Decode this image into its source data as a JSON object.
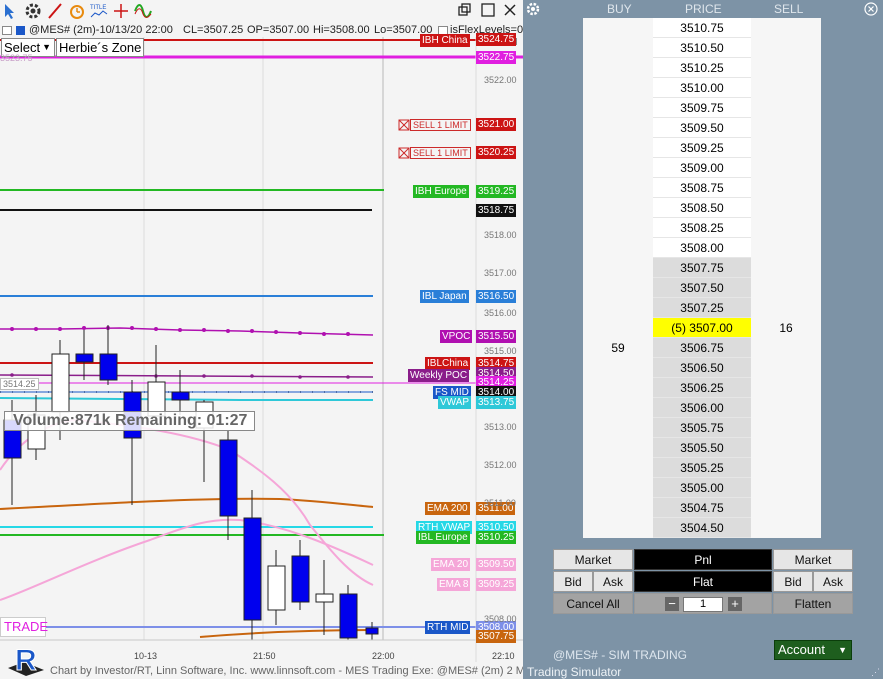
{
  "chart": {
    "title_parts": [
      "@MES# (2m)-10/13/20 22:00",
      "CL=3507.25",
      "OP=3507.00",
      "Hi=3508.00",
      "Lo=3507.00",
      "isFlexLevels=0",
      "M"
    ],
    "select_label": "Select",
    "zone_label": "Herbie´s Zone",
    "volume_text": "Volume:871k Remaining: 01:27",
    "trade_label": "TRADE",
    "footer": "Chart by Investor/RT, Linn Software, Inc. www.linnsoft.com - MES Trading Exe: @MES# (2m) 2 M",
    "left_price_tag": "3514.25",
    "faded_left_tag": "3523.75",
    "axis_ticks": [
      "3522.00",
      "3518.00",
      "3517.00",
      "3516.00",
      "3515.00",
      "3513.00",
      "3512.00",
      "3511.00",
      "3508.00"
    ],
    "time_ticks": [
      "10-13",
      "21:50",
      "22:00",
      "22:10"
    ],
    "level_labels": [
      {
        "text": "IBH China",
        "color": "#cc1414"
      },
      {
        "text": "SELL 1 LIMIT",
        "color": "#cc2a2a"
      },
      {
        "text": "SELL 1 LIMIT",
        "color": "#cc2a2a"
      },
      {
        "text": "IBH Europe",
        "color": "#23b823"
      },
      {
        "text": "IBL Japan",
        "color": "#2a7fd8"
      },
      {
        "text": "VPOC",
        "color": "#b010b0"
      },
      {
        "text": "IBLChina",
        "color": "#cc1414"
      },
      {
        "text": "Weekly POC",
        "color": "#8a1d8a"
      },
      {
        "text": "FS MID",
        "color": "#1a57c8"
      },
      {
        "text": "VWAP",
        "color": "#2ec8d8"
      },
      {
        "text": "EMA 200",
        "color": "#c8650e"
      },
      {
        "text": "RTH VWAP",
        "color": "#25d8e6"
      },
      {
        "text": "IBL Europe",
        "color": "#23b823"
      },
      {
        "text": "EMA 20",
        "color": "#f5a6d8"
      },
      {
        "text": "EMA 8",
        "color": "#f5a6d8"
      },
      {
        "text": "RTH MID",
        "color": "#1a57c8"
      }
    ],
    "price_labels": [
      {
        "text": "3524.75",
        "color": "#cc1414"
      },
      {
        "text": "3522.75",
        "color": "#e01fe0"
      },
      {
        "text": "3521.00",
        "color": "#cc1414"
      },
      {
        "text": "3520.25",
        "color": "#cc1414"
      },
      {
        "text": "3519.25",
        "color": "#23b823"
      },
      {
        "text": "3518.75",
        "color": "#111111"
      },
      {
        "text": "3516.50",
        "color": "#2a7fd8"
      },
      {
        "text": "3515.50",
        "color": "#b010b0"
      },
      {
        "text": "3514.75",
        "color": "#cc1414"
      },
      {
        "text": "3514.50",
        "color": "#8a1d8a"
      },
      {
        "text": "3514.25",
        "color": "#e01fe0"
      },
      {
        "text": "3514.00",
        "color": "#111111"
      },
      {
        "text": "3513.75",
        "color": "#2ec8d8"
      },
      {
        "text": "3511.00",
        "color": "#c8650e"
      },
      {
        "text": "3510.50",
        "color": "#25d8e6"
      },
      {
        "text": "3510.25",
        "color": "#23b823"
      },
      {
        "text": "3509.50",
        "color": "#f5a6d8"
      },
      {
        "text": "3509.25",
        "color": "#f5a6d8"
      },
      {
        "text": "3508.00",
        "color": "#7d8fe8"
      },
      {
        "text": "3507.75",
        "color": "#c8650e"
      }
    ]
  },
  "dom": {
    "headers": {
      "buy": "BUY",
      "price": "PRICE",
      "sell": "SELL"
    },
    "rows": [
      {
        "price": "3510.75",
        "buy": "",
        "sell": ""
      },
      {
        "price": "3510.50",
        "buy": "",
        "sell": ""
      },
      {
        "price": "3510.25",
        "buy": "",
        "sell": ""
      },
      {
        "price": "3510.00",
        "buy": "",
        "sell": ""
      },
      {
        "price": "3509.75",
        "buy": "",
        "sell": ""
      },
      {
        "price": "3509.50",
        "buy": "",
        "sell": ""
      },
      {
        "price": "3509.25",
        "buy": "",
        "sell": ""
      },
      {
        "price": "3509.00",
        "buy": "",
        "sell": ""
      },
      {
        "price": "3508.75",
        "buy": "",
        "sell": ""
      },
      {
        "price": "3508.50",
        "buy": "",
        "sell": ""
      },
      {
        "price": "3508.25",
        "buy": "",
        "sell": ""
      },
      {
        "price": "3508.00",
        "buy": "",
        "sell": ""
      },
      {
        "price": "3507.75",
        "buy": "",
        "sell": ""
      },
      {
        "price": "3507.50",
        "buy": "",
        "sell": ""
      },
      {
        "price": "3507.25",
        "buy": "",
        "sell": ""
      },
      {
        "price": "(5) 3507.00",
        "buy": "",
        "sell": "16"
      },
      {
        "price": "3506.75",
        "buy": "59",
        "sell": ""
      },
      {
        "price": "3506.50",
        "buy": "",
        "sell": ""
      },
      {
        "price": "3506.25",
        "buy": "",
        "sell": ""
      },
      {
        "price": "3506.00",
        "buy": "",
        "sell": ""
      },
      {
        "price": "3505.75",
        "buy": "",
        "sell": ""
      },
      {
        "price": "3505.50",
        "buy": "",
        "sell": ""
      },
      {
        "price": "3505.25",
        "buy": "",
        "sell": ""
      },
      {
        "price": "3505.00",
        "buy": "",
        "sell": ""
      },
      {
        "price": "3504.75",
        "buy": "",
        "sell": ""
      },
      {
        "price": "3504.50",
        "buy": "",
        "sell": ""
      }
    ],
    "market_buy": "Market",
    "pnl_label": "Pnl",
    "market_sell": "Market",
    "bid_buy": "Bid",
    "ask_buy": "Ask",
    "flat_label": "Flat",
    "bid_sell": "Bid",
    "ask_sell": "Ask",
    "cancel_all": "Cancel All",
    "quantity": "1",
    "flatten": "Flatten",
    "status": "@MES# - SIM TRADING",
    "simulator": "Trading Simulator",
    "account": "Account"
  },
  "colors": {
    "dom_bg": "#7d93a6",
    "highlight_price": "#ffff00",
    "bear_candle": "#0000ee",
    "bull_candle": "#ffffff",
    "pnl_bg": "#000000"
  }
}
